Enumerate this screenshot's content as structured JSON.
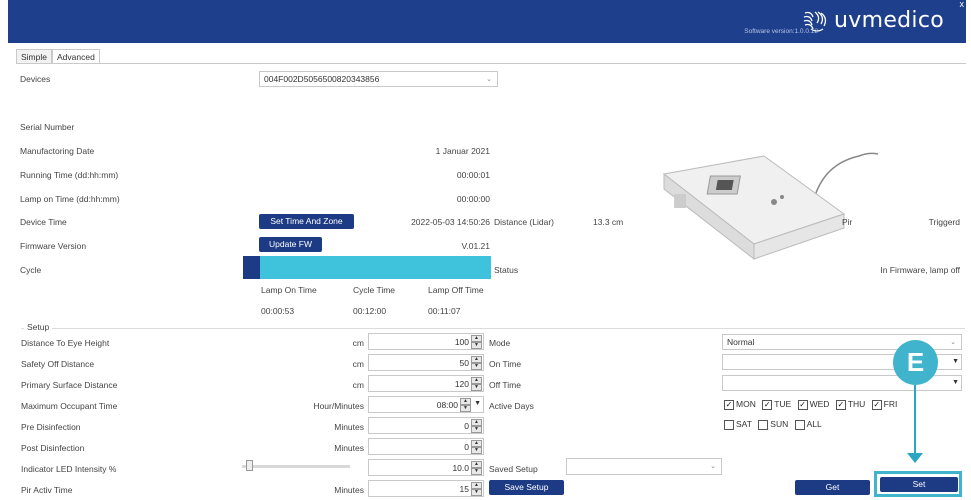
{
  "header": {
    "brand": "uvmedico",
    "close_label": "x",
    "version": "Software version:1.0.0.12"
  },
  "tabs": [
    {
      "label": "Simple"
    },
    {
      "label": "Advanced"
    }
  ],
  "device": {
    "label": "Devices",
    "selected": "004F002D5056500820343856"
  },
  "info": {
    "serial_label": "Serial Number",
    "manufacturing_label": "Manufactoring Date",
    "manufacturing_value": "1 Januar 2021",
    "running_label": "Running Time (dd:hh:mm)",
    "running_value": "00:00:01",
    "lamp_on_label": "Lamp on Time (dd:hh:mm)",
    "lamp_on_value": "00:00:00",
    "device_time_label": "Device Time",
    "device_time_button": "Set Time And Zone",
    "device_time_value": "2022-05-03 14:50:26",
    "distance_label": "Distance (Lidar)",
    "distance_value": "13.3 cm",
    "pir_label": "Pir",
    "pir_value": "Triggerd",
    "firmware_label": "Firmware Version",
    "firmware_button": "Update FW",
    "firmware_value": "V.01.21",
    "cycle_label": "Cycle",
    "status_label": "Status",
    "status_value": "In Firmware, lamp off",
    "cycle_progress": 0.07
  },
  "cycle_times": {
    "headers": [
      "Lamp On Time",
      "Cycle Time",
      "Lamp Off Time"
    ],
    "values": [
      "00:00:53",
      "00:12:00",
      "00:11:07"
    ]
  },
  "setup": {
    "title": "Setup",
    "rows": [
      {
        "label": "Distance To Eye Height",
        "unit": "cm",
        "value": "100"
      },
      {
        "label": "Safety Off Distance",
        "unit": "cm",
        "value": "50"
      },
      {
        "label": "Primary Surface Distance",
        "unit": "cm",
        "value": "120"
      },
      {
        "label": "Maximum Occupant Time",
        "unit": "Hour/Minutes",
        "value": "08:00"
      },
      {
        "label": "Pre Disinfection",
        "unit": "Minutes",
        "value": "0"
      },
      {
        "label": "Post Disinfection",
        "unit": "Minutes",
        "value": "0"
      },
      {
        "label": "Indicator LED Intensity %",
        "unit": "",
        "value": "10.0"
      },
      {
        "label": "Pir Activ Time",
        "unit": "Minutes",
        "value": "15"
      }
    ],
    "mode_label": "Mode",
    "mode_value": "Normal",
    "on_time_label": "On Time",
    "off_time_label": "Off Time",
    "active_days_label": "Active Days",
    "days_row1": [
      {
        "label": "MON",
        "checked": true
      },
      {
        "label": "TUE",
        "checked": true
      },
      {
        "label": "WED",
        "checked": true
      },
      {
        "label": "THU",
        "checked": true
      },
      {
        "label": "FRI",
        "checked": true
      }
    ],
    "days_row2": [
      {
        "label": "SAT",
        "checked": false
      },
      {
        "label": "SUN",
        "checked": false
      },
      {
        "label": "ALL",
        "checked": false
      }
    ],
    "saved_setup_label": "Saved Setup",
    "save_setup_button": "Save Setup",
    "get_button": "Get",
    "set_button": "Set",
    "check_mark": "✓"
  },
  "annotation": {
    "badge_letter": "E"
  },
  "colors": {
    "header_bg": "#1e3f8c",
    "button_bg": "#1d3a84",
    "cycle_bar": "#3fc3dd",
    "annotation": "#3fb4cc"
  }
}
